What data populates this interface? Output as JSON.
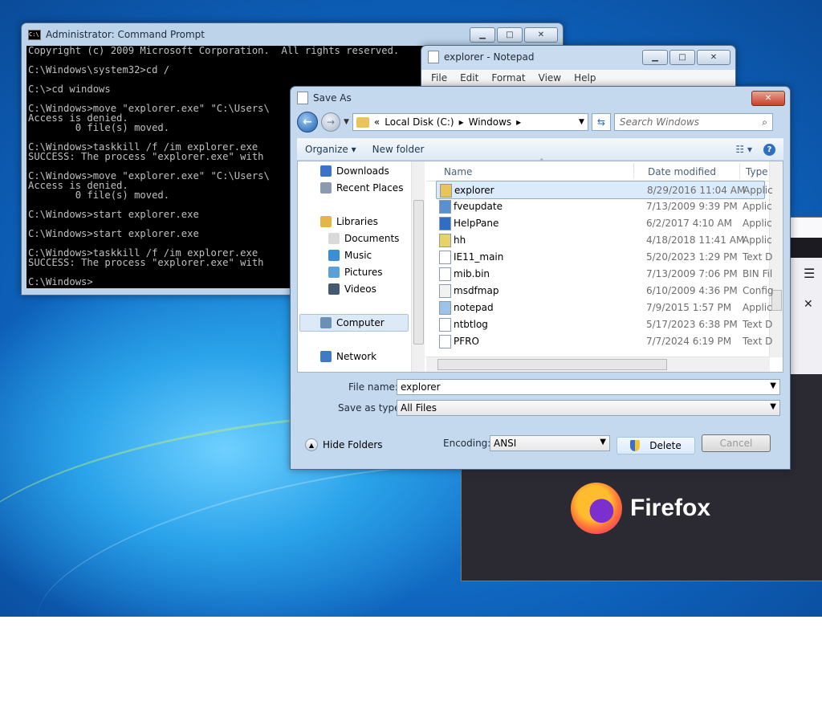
{
  "cmd": {
    "title": "Administrator: Command Prompt",
    "lines": [
      "Copyright (c) 2009 Microsoft Corporation.  All rights reserved.",
      "",
      "C:\\Windows\\system32>cd /",
      "",
      "C:\\>cd windows",
      "",
      "C:\\Windows>move \"explorer.exe\" \"C:\\Users\\",
      "Access is denied.",
      "        0 file(s) moved.",
      "",
      "C:\\Windows>taskkill /f /im explorer.exe",
      "SUCCESS: The process \"explorer.exe\" with",
      "",
      "C:\\Windows>move \"explorer.exe\" \"C:\\Users\\",
      "Access is denied.",
      "        0 file(s) moved.",
      "",
      "C:\\Windows>start explorer.exe",
      "",
      "C:\\Windows>start explorer.exe",
      "",
      "C:\\Windows>taskkill /f /im explorer.exe",
      "SUCCESS: The process \"explorer.exe\" with",
      "",
      "C:\\Windows>"
    ]
  },
  "notepad": {
    "title": "explorer - Notepad",
    "menu": [
      "File",
      "Edit",
      "Format",
      "View",
      "Help"
    ]
  },
  "firefox": {
    "brand": "Firefox"
  },
  "saveas": {
    "title": "Save As",
    "address": {
      "prefix": "«",
      "segments": [
        "Local Disk (C:)",
        "Windows"
      ]
    },
    "search_placeholder": "Search Windows",
    "toolbar": {
      "organize": "Organize",
      "new_folder": "New folder"
    },
    "nav": [
      {
        "label": "Downloads",
        "icon": "downloads-folder-icon",
        "color": "#3a74c8"
      },
      {
        "label": "Recent Places",
        "icon": "recent-places-icon",
        "color": "#8a9bb0"
      },
      {
        "label": "Libraries",
        "icon": "libraries-icon",
        "color": "#e4b647"
      },
      {
        "label": "Documents",
        "icon": "documents-icon",
        "color": "#d9d9d9"
      },
      {
        "label": "Music",
        "icon": "music-icon",
        "color": "#3a8fd6"
      },
      {
        "label": "Pictures",
        "icon": "pictures-icon",
        "color": "#5ba1d8"
      },
      {
        "label": "Videos",
        "icon": "videos-icon",
        "color": "#445a70"
      },
      {
        "label": "Computer",
        "icon": "computer-icon",
        "color": "#6b8fb5"
      },
      {
        "label": "Network",
        "icon": "network-icon",
        "color": "#3d7cc4"
      }
    ],
    "columns": {
      "name": "Name",
      "date": "Date modified",
      "type": "Type"
    },
    "files": [
      {
        "name": "explorer",
        "date": "8/29/2016 11:04 AM",
        "type": "Applic",
        "icon": "folder-icon"
      },
      {
        "name": "fveupdate",
        "date": "7/13/2009 9:39 PM",
        "type": "Applic",
        "icon": "app-icon"
      },
      {
        "name": "HelpPane",
        "date": "6/2/2017 4:10 AM",
        "type": "Applic",
        "icon": "help-icon"
      },
      {
        "name": "hh",
        "date": "4/18/2018 11:41 AM",
        "type": "Applic",
        "icon": "help-file-icon"
      },
      {
        "name": "IE11_main",
        "date": "5/20/2023 1:29 PM",
        "type": "Text D",
        "icon": "text-file-icon"
      },
      {
        "name": "mib.bin",
        "date": "7/13/2009 7:06 PM",
        "type": "BIN Fil",
        "icon": "file-icon"
      },
      {
        "name": "msdfmap",
        "date": "6/10/2009 4:36 PM",
        "type": "Config",
        "icon": "config-file-icon"
      },
      {
        "name": "notepad",
        "date": "7/9/2015 1:57 PM",
        "type": "Applic",
        "icon": "notepad-icon"
      },
      {
        "name": "ntbtlog",
        "date": "5/17/2023 6:38 PM",
        "type": "Text D",
        "icon": "text-file-icon"
      },
      {
        "name": "PFRO",
        "date": "7/7/2024 6:19 PM",
        "type": "Text D",
        "icon": "text-file-icon"
      }
    ],
    "file_name_label": "File name:",
    "file_name_value": "explorer",
    "save_type_label": "Save as type:",
    "save_type_value": "All Files",
    "hide_folders": "Hide Folders",
    "encoding_label": "Encoding:",
    "encoding_value": "ANSI",
    "delete_button": "Delete",
    "cancel_button": "Cancel"
  }
}
